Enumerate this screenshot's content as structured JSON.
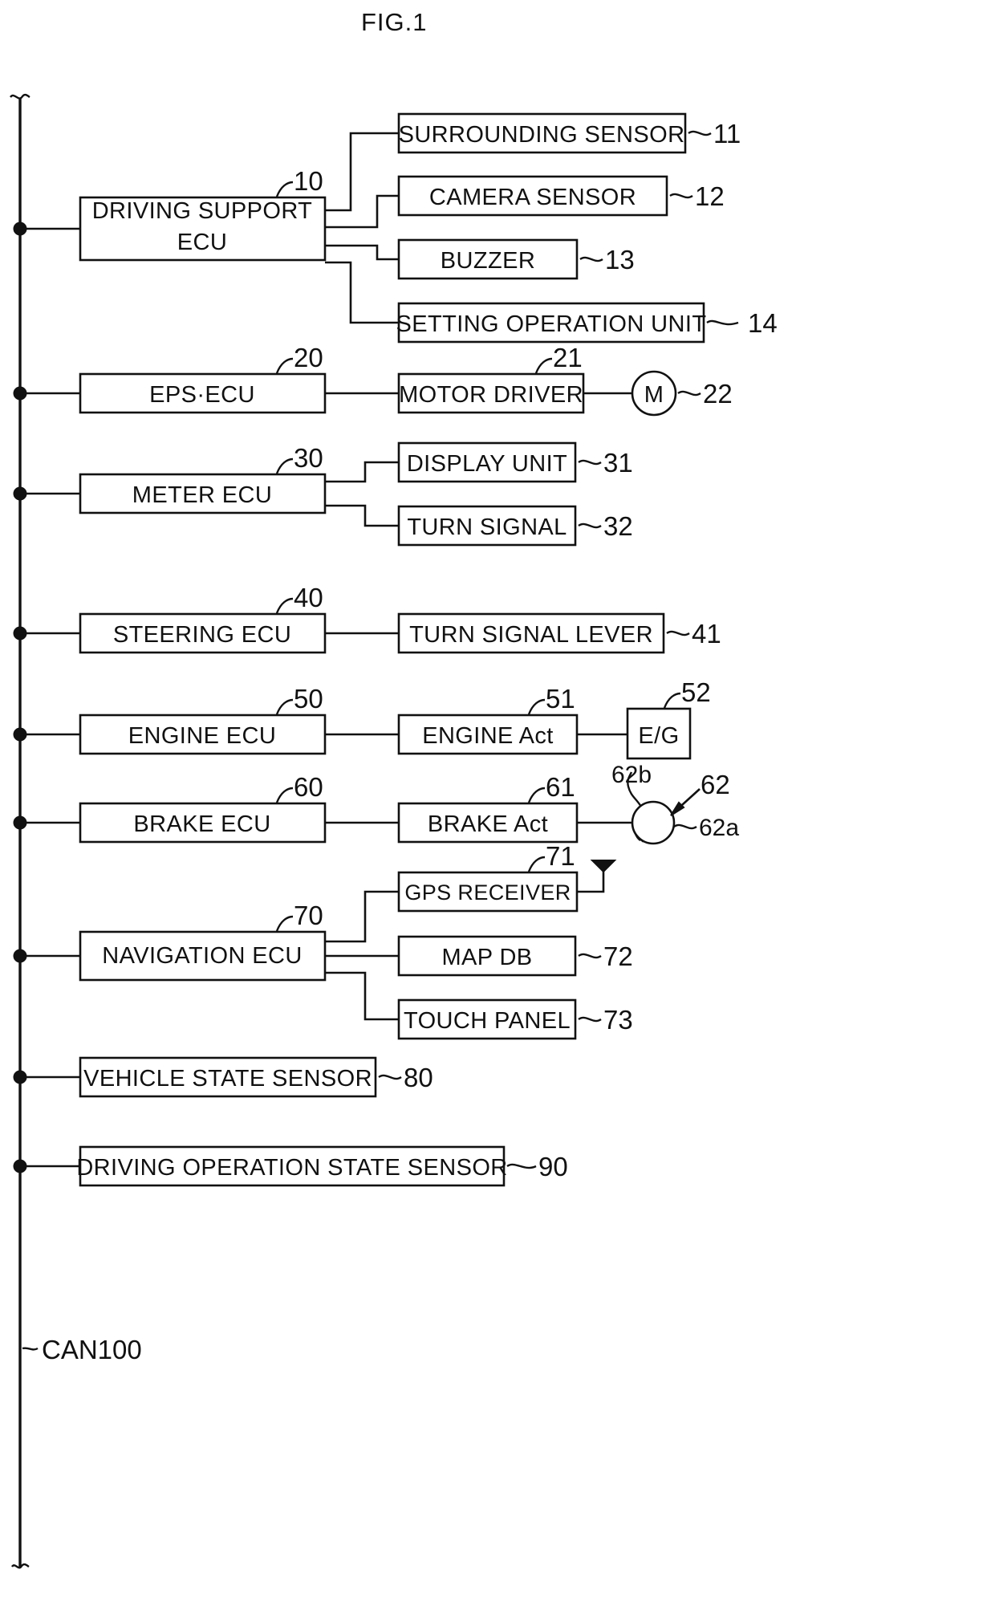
{
  "figure": {
    "title": "FIG.1",
    "bus_label": "CAN100"
  },
  "nodes": {
    "driving_support_ecu": {
      "line1": "DRIVING SUPPORT",
      "line2": "ECU",
      "ref": "10"
    },
    "surrounding_sensor": {
      "label": "SURROUNDING SENSOR",
      "ref": "11"
    },
    "camera_sensor": {
      "label": "CAMERA SENSOR",
      "ref": "12"
    },
    "buzzer": {
      "label": "BUZZER",
      "ref": "13"
    },
    "setting_operation_unit": {
      "label": "SETTING OPERATION UNIT",
      "ref": "14"
    },
    "eps_ecu": {
      "label": "EPS·ECU",
      "ref": "20"
    },
    "motor_driver": {
      "label": "MOTOR DRIVER",
      "ref": "21"
    },
    "motor": {
      "label": "M",
      "ref": "22"
    },
    "meter_ecu": {
      "label": "METER ECU",
      "ref": "30"
    },
    "display_unit": {
      "label": "DISPLAY UNIT",
      "ref": "31"
    },
    "turn_signal": {
      "label": "TURN SIGNAL",
      "ref": "32"
    },
    "steering_ecu": {
      "label": "STEERING ECU",
      "ref": "40"
    },
    "turn_signal_lever": {
      "label": "TURN SIGNAL LEVER",
      "ref": "41"
    },
    "engine_ecu": {
      "label": "ENGINE ECU",
      "ref": "50"
    },
    "engine_act": {
      "label": "ENGINE Act",
      "ref": "51"
    },
    "engine": {
      "label": "E/G",
      "ref": "52"
    },
    "brake_ecu": {
      "label": "BRAKE ECU",
      "ref": "60"
    },
    "brake_act": {
      "label": "BRAKE Act",
      "ref": "61"
    },
    "wheel": {
      "ref": "62",
      "ref_wheel": "62a",
      "ref_pad": "62b"
    },
    "navigation_ecu": {
      "label": "NAVIGATION ECU",
      "ref": "70"
    },
    "gps_receiver": {
      "label": "GPS RECEIVER",
      "ref": "71"
    },
    "map_db": {
      "label": "MAP DB",
      "ref": "72"
    },
    "touch_panel": {
      "label": "TOUCH PANEL",
      "ref": "73"
    },
    "vehicle_state_sensor": {
      "label": "VEHICLE STATE SENSOR",
      "ref": "80"
    },
    "driving_operation_state_sensor": {
      "label": "DRIVING OPERATION STATE SENSOR",
      "ref": "90"
    }
  },
  "icons": {
    "gps_antenna": "antenna-icon",
    "wheel": "wheel-icon",
    "brake_pad": "brake-pad-icon",
    "motor": "motor-circle-icon"
  },
  "colors": {
    "line": "#111111",
    "background": "#ffffff"
  }
}
